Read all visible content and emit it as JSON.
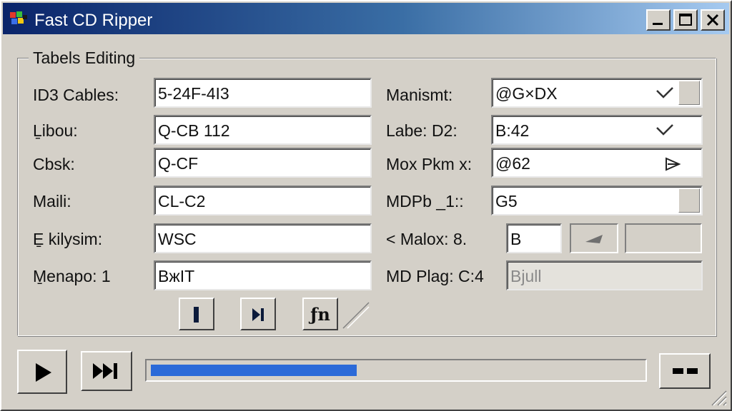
{
  "window": {
    "title": "Fast CD Ripper",
    "controls": [
      "minimize-icon",
      "maximize-icon",
      "close-icon"
    ]
  },
  "group": {
    "legend": "Tabels Editing"
  },
  "left_fields": [
    {
      "label": "ID3 Cables:",
      "value": "5-24F-4I3"
    },
    {
      "label": "Ḻibou:",
      "value": "Q-CB 112"
    },
    {
      "label": "Cbsk:",
      "value": "Q-CF"
    },
    {
      "label": "Maili:",
      "value": "CL-C2"
    },
    {
      "label": "E̱ kilysim:",
      "value": "WSC"
    },
    {
      "label": "M̱enapo: 1",
      "value": "BжIT"
    }
  ],
  "right_fields": [
    {
      "label": "Manismt:",
      "value": "@G×DX",
      "control": "dropdown-check"
    },
    {
      "label": "Labe: D2:",
      "value": "B:42",
      "control": "check"
    },
    {
      "label": "Mox Pkm  x:",
      "value": "@62",
      "control": "arrow"
    },
    {
      "label": "MDPb _1::",
      "value": "G5",
      "control": "dropdown"
    },
    {
      "label": "< Malox: 8.",
      "value": "B",
      "control": "buttons"
    },
    {
      "label": "MD Plag: C:4",
      "value": "Bjull",
      "control": "disabled"
    }
  ],
  "group_buttons": [
    {
      "icon": "bar-icon",
      "label": "I"
    },
    {
      "icon": "next-frame-icon",
      "label": "▸I"
    },
    {
      "icon": "fn-icon",
      "label": "ƒn"
    }
  ],
  "player": {
    "progress_fraction": 0.42,
    "buttons": [
      "play-icon",
      "skip-forward-icon",
      "stop-icon"
    ]
  },
  "colors": {
    "title_start": "#0a246a",
    "title_end": "#a6caf0",
    "progress": "#2b6ad8",
    "face": "#d4d0c8"
  }
}
